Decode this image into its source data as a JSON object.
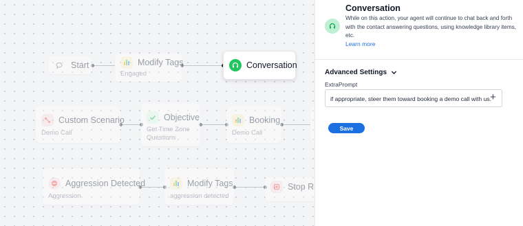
{
  "flow": {
    "start": {
      "label": "Start"
    },
    "modify_tags_1": {
      "label": "Modify Tags",
      "sub": "Engaged"
    },
    "conversation": {
      "label": "Conversation"
    },
    "custom_scenario": {
      "label": "Custom Scenario",
      "sub": "Demo Call"
    },
    "objective": {
      "label": "Objective",
      "sub": "Get Time Zone Questions"
    },
    "booking": {
      "label": "Booking",
      "sub": "Demo Call"
    },
    "aggression_detected": {
      "label": "Aggression Detected",
      "sub": "Aggression"
    },
    "modify_tags_2": {
      "label": "Modify Tags",
      "sub": "aggression detected"
    },
    "stop_response": {
      "label": "Stop Res"
    }
  },
  "panel": {
    "title": "Conversation",
    "description": "While on this action, your agent will continue to chat back and forth with the contact answering questions, using knowledge library items, etc.",
    "learn_more": "Learn more",
    "advanced_settings": "Advanced Settings",
    "extra_prompt_label": "ExtraPrompt",
    "extra_prompt_value": "if appropriate, steer them toward booking a demo call with us.",
    "save_label": "Save"
  },
  "colors": {
    "accent": "#1c6fe0",
    "conversation_green": "#22c55e",
    "link": "#1d6fd8"
  }
}
